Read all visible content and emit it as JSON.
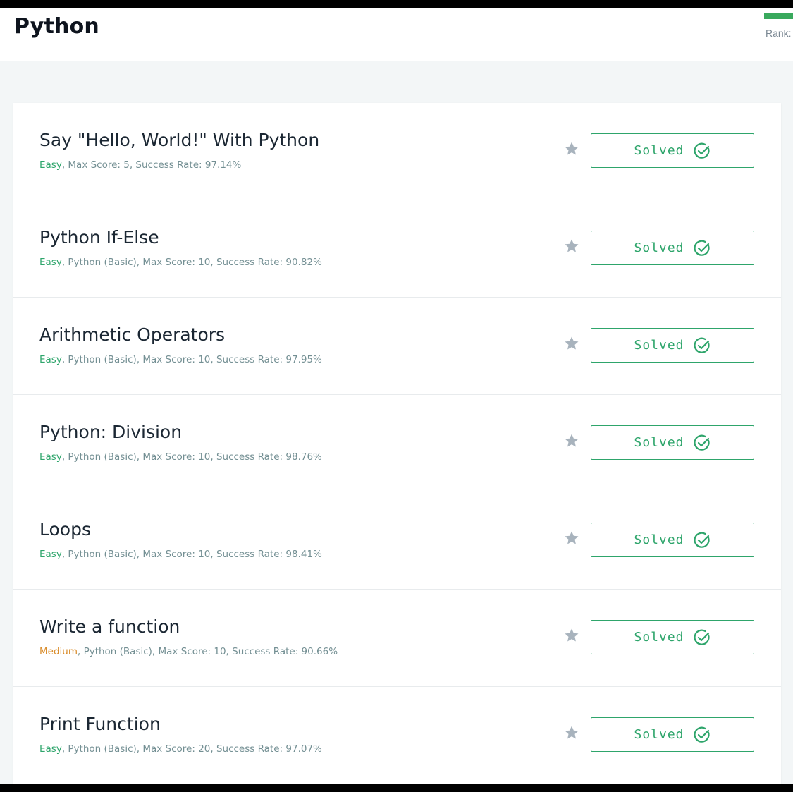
{
  "header": {
    "title": "Python",
    "rank_label": "Rank:",
    "rank_bar_color": "#39a95d"
  },
  "colors": {
    "easy": "#2ea56b",
    "medium": "#d98c2a",
    "solved": "#2ea56b",
    "star": "#a8b3bd"
  },
  "challenges": [
    {
      "title": "Say \"Hello, World!\" With Python",
      "difficulty": "Easy",
      "difficulty_class": "easy",
      "meta": ", Max Score: 5, Success Rate: 97.14%",
      "status": "Solved",
      "star_icon": "star-icon",
      "status_icon": "check-circle-icon"
    },
    {
      "title": "Python If-Else",
      "difficulty": "Easy",
      "difficulty_class": "easy",
      "meta": ", Python (Basic), Max Score: 10, Success Rate: 90.82%",
      "status": "Solved",
      "star_icon": "star-icon",
      "status_icon": "check-circle-icon"
    },
    {
      "title": "Arithmetic Operators",
      "difficulty": "Easy",
      "difficulty_class": "easy",
      "meta": ", Python (Basic), Max Score: 10, Success Rate: 97.95%",
      "status": "Solved",
      "star_icon": "star-icon",
      "status_icon": "check-circle-icon"
    },
    {
      "title": "Python: Division",
      "difficulty": "Easy",
      "difficulty_class": "easy",
      "meta": ", Python (Basic), Max Score: 10, Success Rate: 98.76%",
      "status": "Solved",
      "star_icon": "star-icon",
      "status_icon": "check-circle-icon"
    },
    {
      "title": "Loops",
      "difficulty": "Easy",
      "difficulty_class": "easy",
      "meta": ", Python (Basic), Max Score: 10, Success Rate: 98.41%",
      "status": "Solved",
      "star_icon": "star-icon",
      "status_icon": "check-circle-icon"
    },
    {
      "title": "Write a function",
      "difficulty": "Medium",
      "difficulty_class": "medium",
      "meta": ", Python (Basic), Max Score: 10, Success Rate: 90.66%",
      "status": "Solved",
      "star_icon": "star-icon",
      "status_icon": "check-circle-icon"
    },
    {
      "title": "Print Function",
      "difficulty": "Easy",
      "difficulty_class": "easy",
      "meta": ", Python (Basic), Max Score: 20, Success Rate: 97.07%",
      "status": "Solved",
      "star_icon": "star-icon",
      "status_icon": "check-circle-icon"
    }
  ]
}
